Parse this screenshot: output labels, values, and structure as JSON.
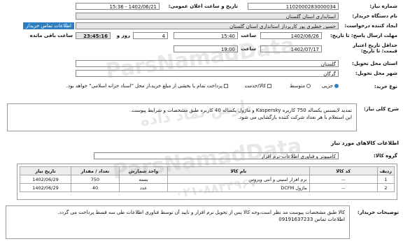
{
  "header": {
    "need_number_label": "شماره نیاز:",
    "need_number": "1102000283000034",
    "announce_label": "تاریخ و ساعت اعلان عمومی:",
    "announce_value": "1402/06/21 - 15:36",
    "buyer_label": "نام دستگاه خریدار:",
    "buyer": "استانداری استان گلستان",
    "creator_label": "ایجاد کننده درخواست:",
    "creator": "حسین خطیری پور کارپرداز استانداری استان گلستان",
    "contact_link": "اطلاعات تماس خریدار",
    "deadline_label": "مهلت ارسال پاسخ: تا تاریخ:",
    "deadline_date": "1402/06/26",
    "time_label": "ساعت",
    "deadline_time": "15:40",
    "days_value": "4",
    "days_label": "روز و",
    "remaining_time": "23:45:16",
    "remaining_label": "ساعت باقی مانده",
    "validity_label": "حداقل تاریخ اعتبار قیمت: تا تاریخ:",
    "validity_date": "1402/07/17",
    "validity_time": "19:00",
    "province_label": "استان محل تحویل:",
    "province": "گلستان",
    "city_label": "شهر محل تحویل:",
    "city": "گرگان",
    "purchase_type_label": "نوع خرید:",
    "purchase_type_partial": "جزیی",
    "purchase_type_medium": "متوسط",
    "goods_checkbox": "کالا/خدمت",
    "payment_note": "پرداخت تمام یا بخشی از مبلغ خرید،از محل \"اسناد خزانه اسلامی\" خواهد بود."
  },
  "summary": {
    "label": "شرح کلی نیاز:",
    "line1": "تمدید لایسنس یکساله 750 کاربره Kaspersky  و ماژول یکساله 40 کاربره طبق مشخصات و شرایط پیوست.",
    "line2": "این استعلام با هر تعداد شرکت کننده بازگشایی می شود."
  },
  "goods": {
    "section_title": "اطلاعات کالاهای مورد نیاز",
    "group_label": "گروه کالا:",
    "group_value": "کامپیوتر و فناوری اطلاعات-نرم افزار",
    "columns": [
      "ردیف",
      "کد کالا",
      "نام کالا",
      "واحد شمارش",
      "تعداد / مقدار",
      "تاریخ نیاز"
    ],
    "rows": [
      [
        "1",
        "--",
        "نرم افزار امنیتی و آنتی ویروس",
        "بسته",
        "750",
        "1402/06/29"
      ],
      [
        "2",
        "--",
        "ماژول DCFM",
        "عدد",
        "40",
        "1402/06/29"
      ]
    ]
  },
  "buyer_notes": {
    "label": "توضیحات خریدار:",
    "line1": "کالا طبق مشخصات پیوست مد نظر است،وجه کالا پس از تحویل نرم افزار و تایید آن توسط فناوری اطلاعات طی  سه قسط پرداخت می گردد.",
    "line2": "اطلاعات تماس 09191637233"
  },
  "watermark": {
    "brand": "ParsNamadData",
    "brand_fa": "پارس نماد داده",
    "phone": "۰۲۱-۸۸۳۴۹۶۷۰"
  },
  "colors": {
    "accent": "#2f7fc0",
    "panel_border": "#9a9a9a",
    "field_grey": "#e6e6e6"
  }
}
